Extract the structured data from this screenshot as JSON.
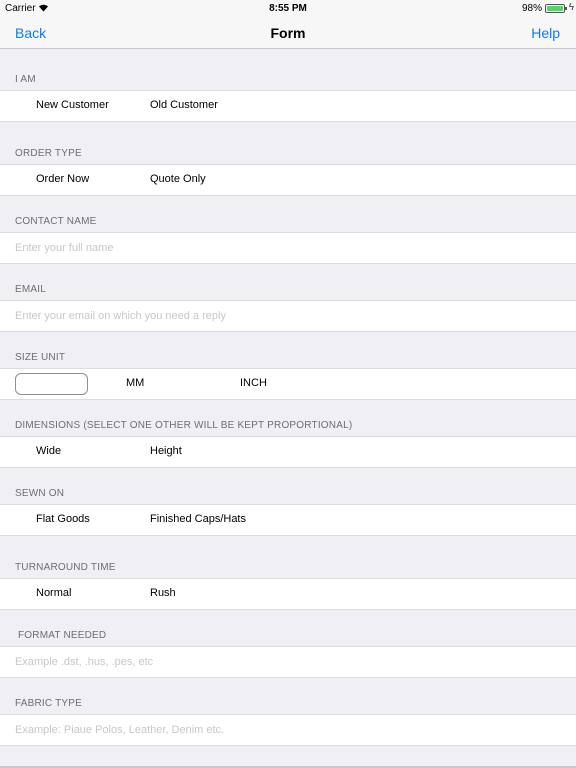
{
  "status_bar": {
    "carrier": "Carrier",
    "time": "8:55 PM",
    "battery_percent": "98%",
    "battery_level": 0.98,
    "icons": [
      "wifi-icon",
      "battery-icon",
      "charging-icon"
    ]
  },
  "nav": {
    "back_label": "Back",
    "title": "Form",
    "help_label": "Help",
    "accent_color": "#0a7aff"
  },
  "sections": {
    "i_am": {
      "header": "I AM",
      "option_a": "New Customer",
      "option_b": "Old Customer"
    },
    "order_type": {
      "header": "ORDER TYPE",
      "option_a": "Order Now",
      "option_b": "Quote Only"
    },
    "contact_name": {
      "header": "CONTACT NAME",
      "placeholder": "Enter your full name"
    },
    "email": {
      "header": "EMAIL",
      "placeholder": "Enter your email on which you need a reply"
    },
    "size_unit": {
      "header": "SIZE UNIT",
      "option_mm": "MM",
      "option_inch": "INCH"
    },
    "dimensions": {
      "header": "DIMENSIONS (SELECT ONE OTHER WILL BE KEPT PROPORTIONAL)",
      "option_a": "Wide",
      "option_b": "Height"
    },
    "sewn_on": {
      "header": "SEWN ON",
      "option_a": "Flat Goods",
      "option_b": "Finished Caps/Hats"
    },
    "turnaround": {
      "header": "TURNAROUND TIME",
      "option_a": "Normal",
      "option_b": "Rush"
    },
    "format_needed": {
      "header": "FORMAT NEEDED",
      "placeholder": "Example .dst, .hus, .pes, etc"
    },
    "fabric_type": {
      "header": "FABRIC TYPE",
      "placeholder": "Example: Piaue Polos, Leather, Denim etc."
    }
  }
}
